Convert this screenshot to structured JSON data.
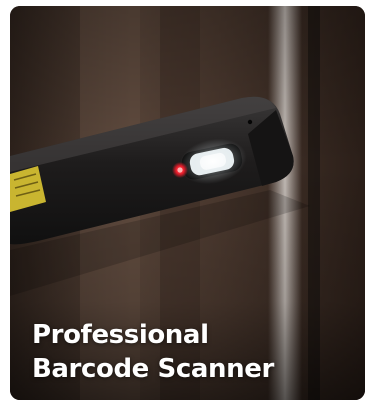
{
  "card": {
    "caption_line_1": "Professional",
    "caption_line_2": "Barcode Scanner",
    "colors": {
      "background": "#3a2b23",
      "device_body": "#1e1c1c",
      "scan_window": "#e9eff1",
      "laser_dot": "#e81c2a",
      "label_yellow": "#c9b530",
      "text": "#ffffff"
    }
  }
}
